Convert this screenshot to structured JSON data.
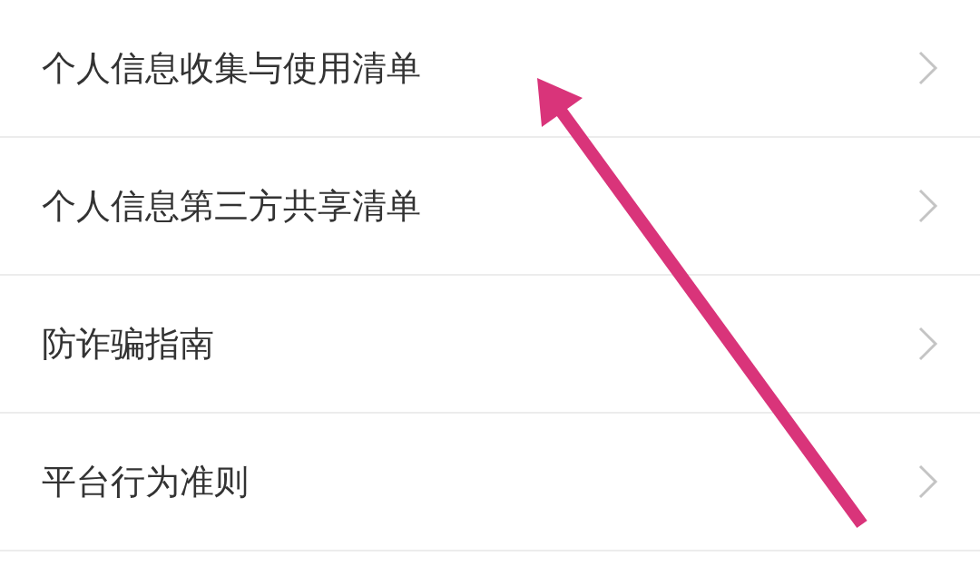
{
  "menu_items": [
    {
      "label": "个人信息收集与使用清单"
    },
    {
      "label": "个人信息第三方共享清单"
    },
    {
      "label": "防诈骗指南"
    },
    {
      "label": "平台行为准则"
    }
  ]
}
